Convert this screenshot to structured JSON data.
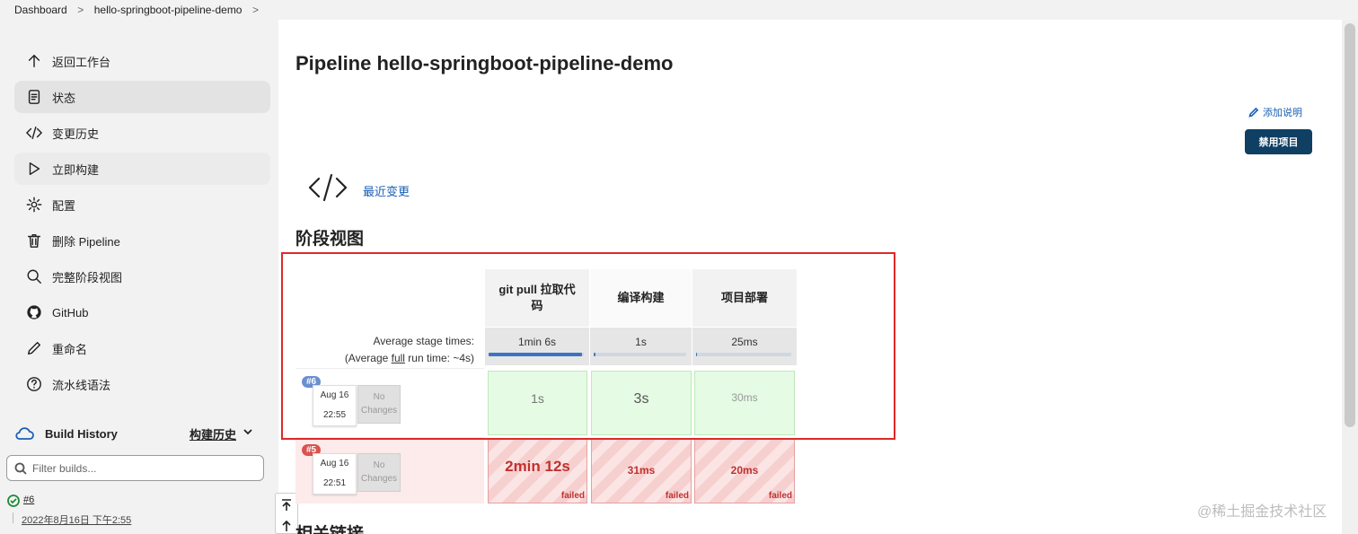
{
  "breadcrumb": {
    "items": [
      "Dashboard",
      "hello-springboot-pipeline-demo"
    ],
    "sep": ">"
  },
  "sidebar": {
    "items": [
      {
        "label": "返回工作台",
        "icon": "arrow-up-icon"
      },
      {
        "label": "状态",
        "icon": "document-icon"
      },
      {
        "label": "变更历史",
        "icon": "code-icon"
      },
      {
        "label": "立即构建",
        "icon": "play-icon"
      },
      {
        "label": "配置",
        "icon": "gear-icon"
      },
      {
        "label": "删除 Pipeline",
        "icon": "trash-icon"
      },
      {
        "label": "完整阶段视图",
        "icon": "search-icon"
      },
      {
        "label": "GitHub",
        "icon": "github-icon"
      },
      {
        "label": "重命名",
        "icon": "pencil-icon"
      },
      {
        "label": "流水线语法",
        "icon": "help-circle-icon"
      }
    ]
  },
  "build_history": {
    "title": "Build History",
    "trend": "构建历史",
    "filter_placeholder": "Filter builds...",
    "builds": [
      {
        "number": "#6",
        "date": "2022年8月16日 下午2:55",
        "status": "success"
      }
    ]
  },
  "main": {
    "title": "Pipeline hello-springboot-pipeline-demo",
    "add_description": "添加说明",
    "disable_button": "禁用项目",
    "recent_changes": "最近变更",
    "stage_view_heading": "阶段视图",
    "related_links_heading": "相关链接"
  },
  "stage_view": {
    "avg_label_line1": "Average stage times:",
    "avg_label_line2_pre": "(Average ",
    "avg_label_line2_link": "full",
    "avg_label_line2_post": " run time: ~4s)",
    "stages": [
      {
        "name": "git pull 拉取代码",
        "avg": "1min 6s",
        "progress": 0.98
      },
      {
        "name": "编译构建",
        "avg": "1s",
        "progress": 0.02
      },
      {
        "name": "项目部署",
        "avg": "25ms",
        "progress": 0.01
      }
    ],
    "runs": [
      {
        "badge": "#6",
        "date": "Aug 16",
        "time": "22:55",
        "no_changes": "No Changes",
        "status": "success",
        "cells": [
          "1s",
          "3s",
          "30ms"
        ]
      },
      {
        "badge": "#5",
        "date": "Aug 16",
        "time": "22:51",
        "no_changes": "No Changes",
        "status": "failed",
        "cells": [
          "2min 12s",
          "31ms",
          "20ms"
        ],
        "failed_label": "failed"
      }
    ]
  },
  "colors": {
    "accent": "#1a5fb4",
    "disable_button": "#0f3f63",
    "highlight_box": "#e02828",
    "success_cell": "#e5fbe3",
    "failed_text": "#c0312f"
  },
  "watermark": "@稀土掘金技术社区"
}
